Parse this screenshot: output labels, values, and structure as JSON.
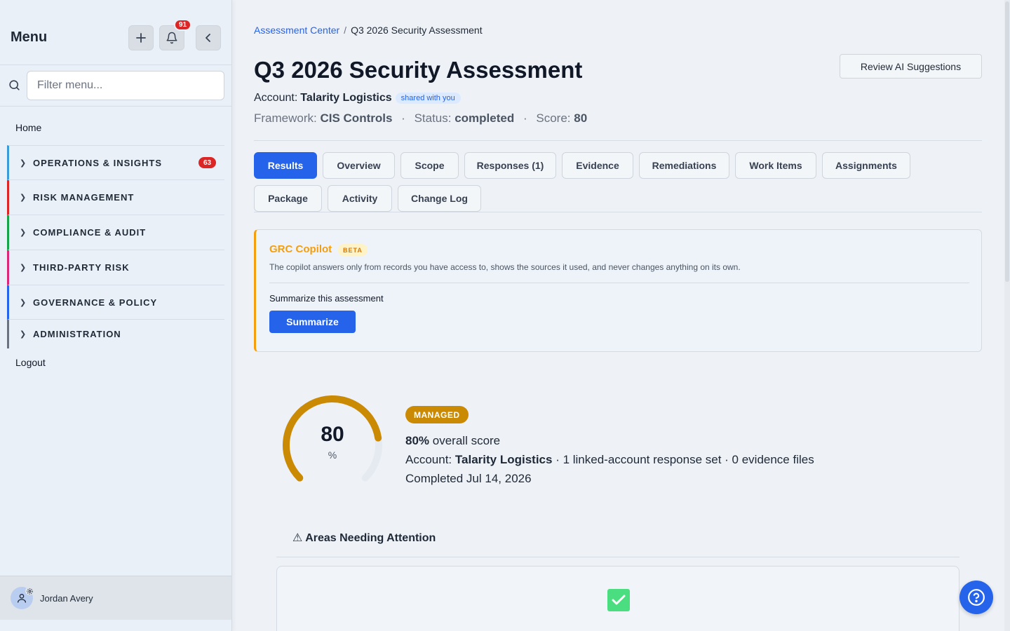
{
  "sidebar": {
    "title": "Menu",
    "notification_count": "91",
    "add_icon": "plus-icon",
    "bell_icon": "bell-icon",
    "collapse_icon": "chevron-left-icon",
    "filter_placeholder": "Filter menu...",
    "home": "Home",
    "groups": [
      {
        "label": "OPERATIONS & INSIGHTS",
        "count": "63",
        "color": "#3b9bd9"
      },
      {
        "label": "RISK MANAGEMENT",
        "color": "#dc2626"
      },
      {
        "label": "COMPLIANCE & AUDIT",
        "color": "#16a34a"
      },
      {
        "label": "THIRD-PARTY RISK",
        "color": "#db2777"
      },
      {
        "label": "GOVERNANCE & POLICY",
        "color": "#2563eb"
      },
      {
        "label": "ADMINISTRATION",
        "color": "#6b7280"
      }
    ],
    "logout": "Logout",
    "user_name": "Jordan Avery"
  },
  "breadcrumb": {
    "parent": "Assessment Center",
    "separator": "/",
    "current": "Q3 2026 Security Assessment"
  },
  "page": {
    "title": "Q3 2026 Security Assessment",
    "review_button": "Review AI Suggestions",
    "account_label": "Account:",
    "account_name": "Talarity Logistics",
    "shared_badge": "shared with you",
    "framework_label": "Framework:",
    "framework": "CIS Controls",
    "status_label": "Status:",
    "status": "completed",
    "score_label": "Score:",
    "score": "80",
    "dot": "·"
  },
  "tabs": [
    {
      "label": "Results",
      "active": true
    },
    {
      "label": "Overview"
    },
    {
      "label": "Scope"
    },
    {
      "label": "Responses (1)"
    },
    {
      "label": "Evidence"
    },
    {
      "label": "Remediations"
    },
    {
      "label": "Work Items"
    },
    {
      "label": "Assignments"
    },
    {
      "label": "Package"
    },
    {
      "label": "Activity"
    },
    {
      "label": "Change Log"
    }
  ],
  "copilot": {
    "title": "GRC Copilot",
    "badge": "BETA",
    "description": "The copilot answers only from records you have access to, shows the sources it used, and never changes anything on its own.",
    "prompt": "Summarize this assessment",
    "button": "Summarize"
  },
  "results": {
    "gauge_value": 80,
    "gauge_number": "80",
    "gauge_unit": "%",
    "gauge_color": "#ca8a04",
    "gauge_track_color": "#e5eaf0",
    "level": "MANAGED",
    "score_pct": "80%",
    "score_text": "overall score",
    "account_label": "Account:",
    "account_name": "Talarity Logistics",
    "account_rest": "· 1 linked-account response set · 0 evidence files",
    "completed": "Completed Jul 14, 2026"
  },
  "attention": {
    "icon": "warning-icon",
    "icon_glyph": "⚠",
    "title": "Areas Needing Attention",
    "status_icon": "check-square-icon"
  },
  "help": {
    "icon": "help-circle-icon"
  },
  "colors": {
    "primary": "#2563eb",
    "accent": "#f59e0b",
    "danger": "#dc2626"
  }
}
